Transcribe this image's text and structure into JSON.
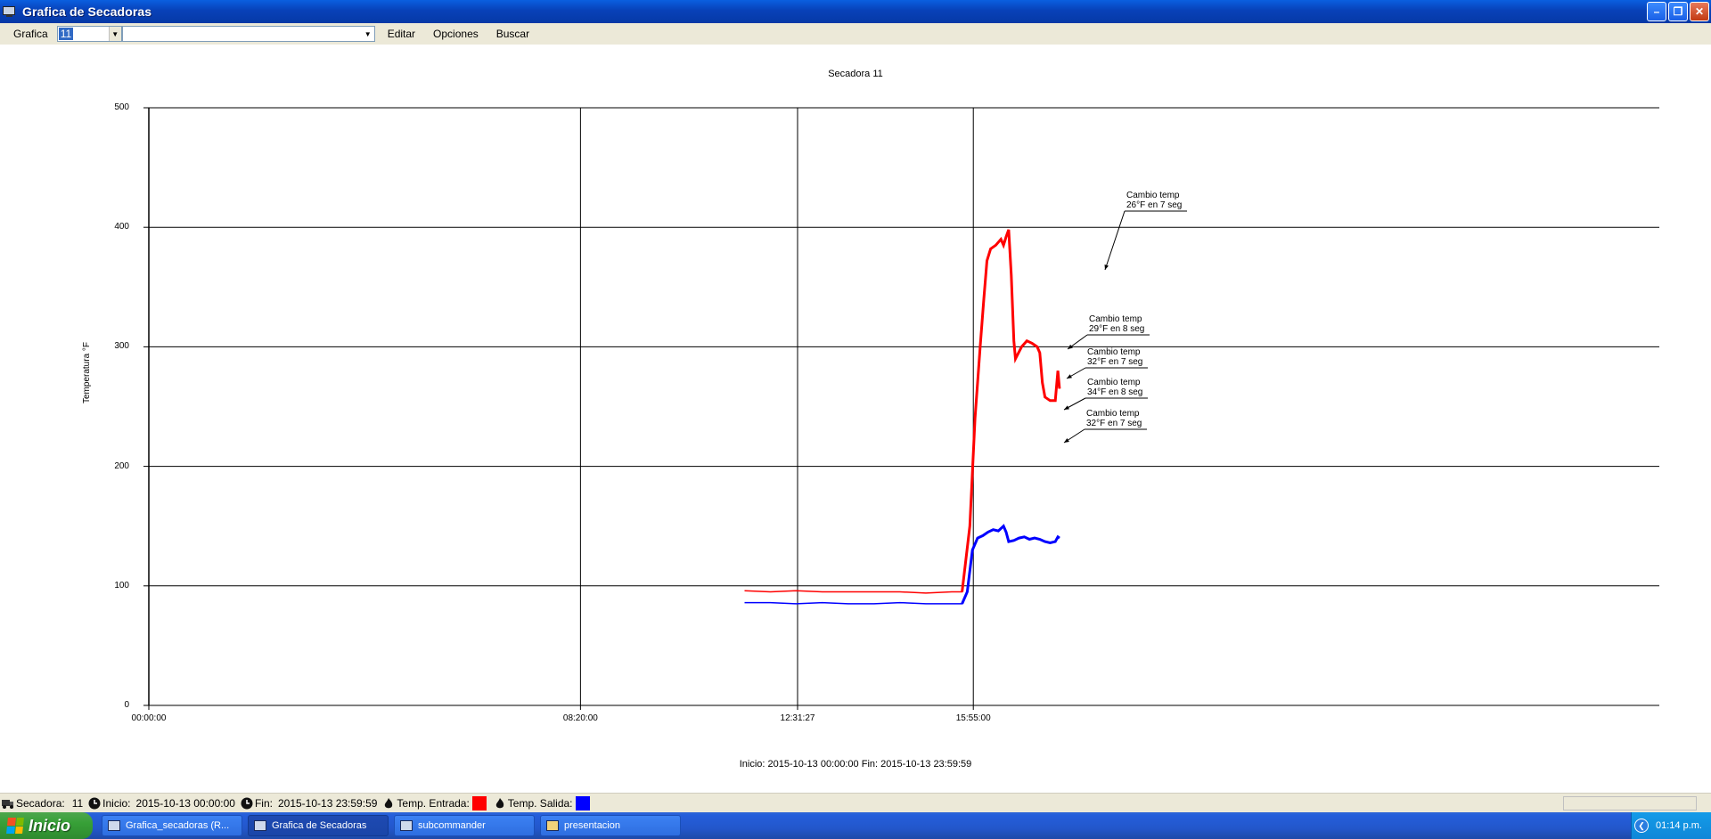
{
  "window": {
    "title": "Grafica de Secadoras"
  },
  "menu": {
    "grafica_label": "Grafica",
    "combo_value": "11",
    "combo2_value": "",
    "editar": "Editar",
    "opciones": "Opciones",
    "buscar": "Buscar"
  },
  "chart_data": {
    "type": "line",
    "title": "Secadora 11",
    "ylabel": "Temperatura °F",
    "xlabel": "",
    "ylim": [
      0,
      500
    ],
    "yticks": [
      "0",
      "100",
      "200",
      "300",
      "400",
      "500"
    ],
    "xticks": [
      "00:00:00",
      "08:20:00",
      "12:31:27",
      "15:55:00"
    ],
    "x_unit": "hours since 00:00:00",
    "grid": true,
    "footer": "Inicio: 2015-10-13 00:00:00 Fin: 2015-10-13 23:59:59",
    "series": [
      {
        "name": "Temp. Entrada",
        "color": "#ff0000",
        "points": [
          [
            11.5,
            96
          ],
          [
            12.0,
            95
          ],
          [
            12.5,
            96
          ],
          [
            13.0,
            95
          ],
          [
            13.5,
            95
          ],
          [
            14.0,
            95
          ],
          [
            14.5,
            95
          ],
          [
            15.0,
            94
          ],
          [
            15.5,
            95
          ],
          [
            15.7,
            95
          ],
          [
            15.85,
            150
          ],
          [
            15.95,
            240
          ],
          [
            16.05,
            300
          ],
          [
            16.12,
            340
          ],
          [
            16.18,
            372
          ],
          [
            16.25,
            382
          ],
          [
            16.35,
            385
          ],
          [
            16.45,
            390
          ],
          [
            16.5,
            385
          ],
          [
            16.55,
            392
          ],
          [
            16.6,
            398
          ],
          [
            16.65,
            360
          ],
          [
            16.7,
            305
          ],
          [
            16.73,
            290
          ],
          [
            16.85,
            300
          ],
          [
            16.95,
            305
          ],
          [
            17.05,
            303
          ],
          [
            17.15,
            300
          ],
          [
            17.2,
            295
          ],
          [
            17.25,
            270
          ],
          [
            17.3,
            258
          ],
          [
            17.4,
            255
          ],
          [
            17.5,
            255
          ],
          [
            17.55,
            280
          ],
          [
            17.58,
            265
          ]
        ]
      },
      {
        "name": "Temp. Salida",
        "color": "#0000ff",
        "points": [
          [
            11.5,
            86
          ],
          [
            12.0,
            86
          ],
          [
            12.5,
            85
          ],
          [
            13.0,
            86
          ],
          [
            13.5,
            85
          ],
          [
            14.0,
            85
          ],
          [
            14.5,
            86
          ],
          [
            15.0,
            85
          ],
          [
            15.5,
            85
          ],
          [
            15.7,
            85
          ],
          [
            15.8,
            95
          ],
          [
            15.9,
            130
          ],
          [
            16.0,
            140
          ],
          [
            16.1,
            142
          ],
          [
            16.2,
            145
          ],
          [
            16.3,
            147
          ],
          [
            16.4,
            146
          ],
          [
            16.5,
            150
          ],
          [
            16.55,
            145
          ],
          [
            16.6,
            137
          ],
          [
            16.7,
            138
          ],
          [
            16.8,
            140
          ],
          [
            16.9,
            141
          ],
          [
            17.0,
            139
          ],
          [
            17.1,
            140
          ],
          [
            17.2,
            139
          ],
          [
            17.3,
            137
          ],
          [
            17.4,
            136
          ],
          [
            17.5,
            137
          ],
          [
            17.55,
            141
          ],
          [
            17.58,
            140
          ]
        ]
      }
    ],
    "annotations": [
      {
        "line1": "Cambio temp",
        "line2": "26°F en 7 seg"
      },
      {
        "line1": "Cambio temp",
        "line2": "29°F en 8 seg"
      },
      {
        "line1": "Cambio temp",
        "line2": "32°F en 7 seg"
      },
      {
        "line1": "Cambio temp",
        "line2": "34°F en 8 seg"
      },
      {
        "line1": "Cambio temp",
        "line2": "32°F en 7 seg"
      }
    ]
  },
  "status": {
    "secadora_label": "Secadora:",
    "secadora_value": "11",
    "inicio_label": "Inicio:",
    "inicio_value": "2015-10-13 00:00:00",
    "fin_label": "Fin:",
    "fin_value": "2015-10-13 23:59:59",
    "entrada_label": "Temp. Entrada:",
    "entrada_color": "#ff0000",
    "salida_label": "Temp. Salida:",
    "salida_color": "#0000ff"
  },
  "taskbar": {
    "start": "Inicio",
    "tasks": [
      "Grafica_secadoras (R...",
      "Grafica de Secadoras",
      "subcommander",
      "presentacion"
    ],
    "clock": "01:14 p.m."
  }
}
